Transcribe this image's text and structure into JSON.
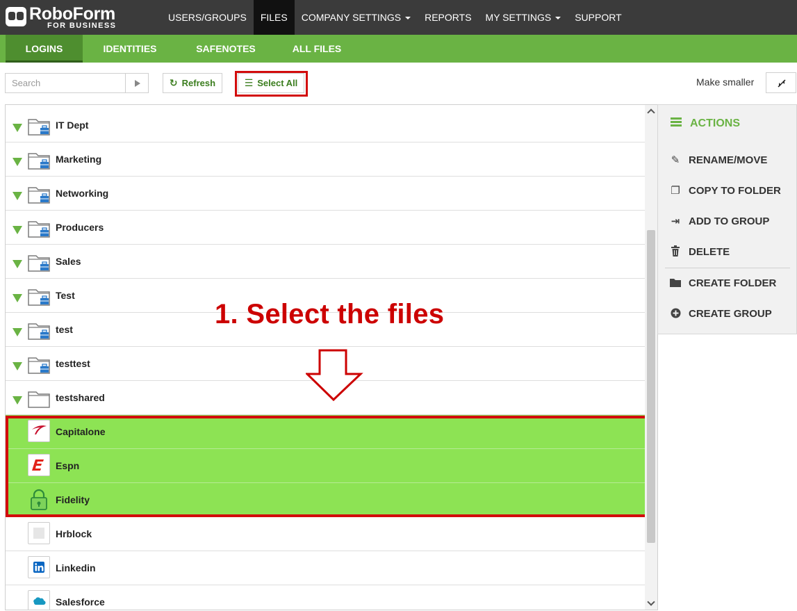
{
  "app": {
    "logo_name": "RoboForm",
    "logo_sub": "FOR BUSINESS"
  },
  "top_nav": [
    {
      "label": "USERS/GROUPS",
      "dropdown": false,
      "active": false
    },
    {
      "label": "FILES",
      "dropdown": false,
      "active": true
    },
    {
      "label": "COMPANY SETTINGS",
      "dropdown": true,
      "active": false
    },
    {
      "label": "REPORTS",
      "dropdown": false,
      "active": false
    },
    {
      "label": "MY SETTINGS",
      "dropdown": true,
      "active": false
    },
    {
      "label": "SUPPORT",
      "dropdown": false,
      "active": false
    }
  ],
  "sub_nav": [
    {
      "label": "LOGINS",
      "active": true
    },
    {
      "label": "IDENTITIES",
      "active": false
    },
    {
      "label": "SAFENOTES",
      "active": false
    },
    {
      "label": "ALL FILES",
      "active": false
    }
  ],
  "toolbar": {
    "search_placeholder": "Search",
    "refresh_label": "Refresh",
    "select_all_label": "Select All",
    "make_smaller_label": "Make smaller"
  },
  "list": {
    "rows": [
      {
        "name": "IT Dept",
        "kind": "shared-folder",
        "selected": false
      },
      {
        "name": "Marketing",
        "kind": "shared-folder",
        "selected": false
      },
      {
        "name": "Networking",
        "kind": "shared-folder",
        "selected": false
      },
      {
        "name": "Producers",
        "kind": "shared-folder",
        "selected": false
      },
      {
        "name": "Sales",
        "kind": "shared-folder",
        "selected": false
      },
      {
        "name": "Test",
        "kind": "shared-folder",
        "selected": false
      },
      {
        "name": "test",
        "kind": "shared-folder",
        "selected": false
      },
      {
        "name": "testtest",
        "kind": "shared-folder",
        "selected": false
      },
      {
        "name": "testshared",
        "kind": "folder",
        "selected": false
      },
      {
        "name": "Capitalone",
        "kind": "login",
        "icon": "capitalone-icon",
        "selected": true
      },
      {
        "name": "Espn",
        "kind": "login",
        "icon": "espn-icon",
        "selected": true
      },
      {
        "name": "Fidelity",
        "kind": "login",
        "icon": "lock-icon",
        "selected": true
      },
      {
        "name": "Hrblock",
        "kind": "login",
        "icon": "hrblock-icon",
        "selected": false
      },
      {
        "name": "Linkedin",
        "kind": "login",
        "icon": "linkedin-icon",
        "selected": false
      },
      {
        "name": "Salesforce",
        "kind": "login",
        "icon": "salesforce-icon",
        "selected": false
      }
    ]
  },
  "actions": {
    "title": "ACTIONS",
    "items": [
      {
        "label": "RENAME/MOVE",
        "icon": "pencil-icon"
      },
      {
        "label": "COPY TO FOLDER",
        "icon": "copy-icon"
      },
      {
        "label": "ADD TO GROUP",
        "icon": "sign-in-icon"
      },
      {
        "label": "DELETE",
        "icon": "trash-icon"
      },
      {
        "label": "CREATE FOLDER",
        "icon": "folder-icon"
      },
      {
        "label": "CREATE GROUP",
        "icon": "plus-circle-icon"
      }
    ]
  },
  "annotation": {
    "text": "1. Select the files"
  },
  "colors": {
    "topbar": "#3b3b3b",
    "brand_green": "#6ab344",
    "selected_row": "#8de354",
    "highlight_red": "#d20c0c",
    "annotation_red": "#cc0000"
  }
}
